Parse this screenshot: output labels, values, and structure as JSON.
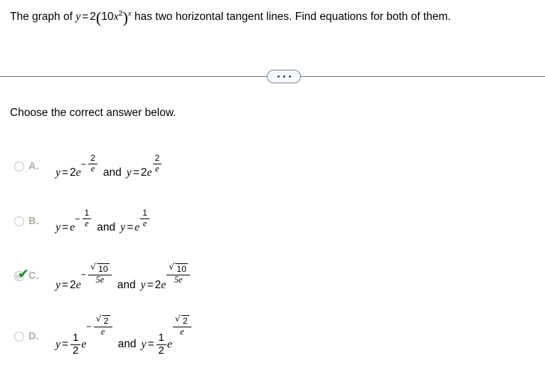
{
  "question": {
    "lead": "The graph of ",
    "equation": {
      "lhs": "y",
      "eq": "=",
      "coefficient": "2",
      "open_paren": "(",
      "inner_coefficient": "10",
      "inner_var": "x",
      "inner_exponent": "2",
      "close_paren": ")",
      "outer_exponent": "x"
    },
    "tail": " has two horizontal tangent lines. Find equations for both of them."
  },
  "divider": {
    "ellipsis_label": "...",
    "dot_count": 3
  },
  "prompt": "Choose the correct answer below.",
  "options": [
    {
      "letter": "A.",
      "selected": false,
      "checked": false,
      "left": {
        "y": "y",
        "eq": "=",
        "coefficient": "2",
        "base": "e",
        "sign": "−",
        "numerator": "2",
        "denominator": "e"
      },
      "conjunction": "and",
      "right": {
        "y": "y",
        "eq": "=",
        "coefficient": "2",
        "base": "e",
        "sign": "",
        "numerator": "2",
        "denominator": "e"
      }
    },
    {
      "letter": "B.",
      "selected": false,
      "checked": false,
      "left": {
        "y": "y",
        "eq": "=",
        "coefficient": "",
        "base": "e",
        "sign": "−",
        "numerator": "1",
        "denominator": "e"
      },
      "conjunction": "and",
      "right": {
        "y": "y",
        "eq": "=",
        "coefficient": "",
        "base": "e",
        "sign": "",
        "numerator": "1",
        "denominator": "e"
      }
    },
    {
      "letter": "C.",
      "selected": true,
      "checked": true,
      "left": {
        "y": "y",
        "eq": "=",
        "coefficient": "2",
        "base": "e",
        "sign": "−",
        "numerator_radicand": "10",
        "denominator": "5e"
      },
      "conjunction": "and",
      "right": {
        "y": "y",
        "eq": "=",
        "coefficient": "2",
        "base": "e",
        "sign": "",
        "numerator_radicand": "10",
        "denominator": "5e"
      }
    },
    {
      "letter": "D.",
      "selected": false,
      "checked": false,
      "left": {
        "y": "y",
        "eq": "=",
        "coef_num": "1",
        "coef_den": "2",
        "base": "e",
        "sign": "−",
        "numerator_radicand": "2",
        "denominator": "e"
      },
      "conjunction": "and",
      "right": {
        "y": "y",
        "eq": "=",
        "coef_num": "1",
        "coef_den": "2",
        "base": "e",
        "sign": "",
        "numerator_radicand": "2",
        "denominator": "e"
      }
    }
  ],
  "colors": {
    "text": "#000000",
    "option_letter": "#b3b0a8",
    "radio_border": "#c3c3c3",
    "checkmark_green": "#0f8c2e",
    "divider": "#6b7280",
    "pill_fill": "#f7f8fa"
  },
  "radical_glyph": "√"
}
